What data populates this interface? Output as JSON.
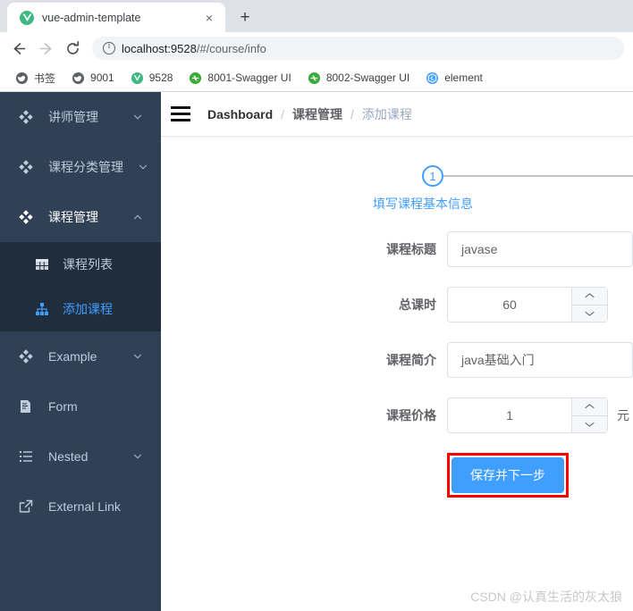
{
  "browser": {
    "tab": {
      "title": "vue-admin-template",
      "favicon": "vue-logo-icon",
      "close": "×"
    },
    "new_tab_label": "+",
    "nav": {
      "back": "←",
      "forward": "→",
      "reload": "↻"
    },
    "address": {
      "host": "localhost:9528",
      "path": "/#/course/info",
      "security_icon": "info-circle-icon"
    },
    "bookmarks": [
      {
        "label": "书签",
        "icon": "globe-icon",
        "color": "#5f6368"
      },
      {
        "label": "9001",
        "icon": "globe-icon",
        "color": "#5f6368"
      },
      {
        "label": "9528",
        "icon": "vue-logo-icon",
        "color": "#41b883"
      },
      {
        "label": "8001-Swagger UI",
        "icon": "swagger-icon",
        "color": "#3cab3c"
      },
      {
        "label": "8002-Swagger UI",
        "icon": "swagger-icon",
        "color": "#3cab3c"
      },
      {
        "label": "element",
        "icon": "element-ui-icon",
        "color": "#409eff"
      }
    ]
  },
  "sidebar": {
    "items": [
      {
        "label": "讲师管理",
        "icon": "component-icon",
        "arrow": "chevron-down",
        "active": false
      },
      {
        "label": "课程分类管理",
        "icon": "component-icon",
        "arrow": "chevron-down",
        "active": false
      },
      {
        "label": "课程管理",
        "icon": "component-icon",
        "arrow": "chevron-up",
        "active": false
      }
    ],
    "submenu": [
      {
        "label": "课程列表",
        "icon": "table-icon",
        "active": false
      },
      {
        "label": "添加课程",
        "icon": "tree-icon",
        "active": true
      }
    ],
    "items_after": [
      {
        "label": "Example",
        "icon": "component-icon",
        "arrow": "chevron-down"
      },
      {
        "label": "Form",
        "icon": "form-icon",
        "arrow": ""
      },
      {
        "label": "Nested",
        "icon": "nested-icon",
        "arrow": "chevron-down"
      },
      {
        "label": "External Link",
        "icon": "external-link-icon",
        "arrow": ""
      }
    ]
  },
  "navbar": {
    "hamburger": "hamburger-icon",
    "breadcrumb": [
      {
        "label": "Dashboard"
      },
      {
        "label": "课程管理"
      },
      {
        "label": "添加课程"
      }
    ],
    "separator": "/"
  },
  "stepper": {
    "current": 1,
    "steps": [
      {
        "number": "1",
        "title": "填写课程基本信息"
      }
    ]
  },
  "form": {
    "rows": [
      {
        "label": "课程标题",
        "value": "javase",
        "type": "text"
      },
      {
        "label": "总课时",
        "value": "60",
        "type": "number"
      },
      {
        "label": "课程简介",
        "value": "java基础入门",
        "type": "text"
      },
      {
        "label": "课程价格",
        "value": "1",
        "type": "number",
        "unit": "元"
      }
    ],
    "submit_label": "保存并下一步"
  },
  "watermark": "CSDN @认真生活的灰太狼",
  "colors": {
    "accent": "#409eff",
    "sidebar_bg": "#304156",
    "submenu_bg": "#1f2d3d",
    "annotation": "#ff0000"
  }
}
